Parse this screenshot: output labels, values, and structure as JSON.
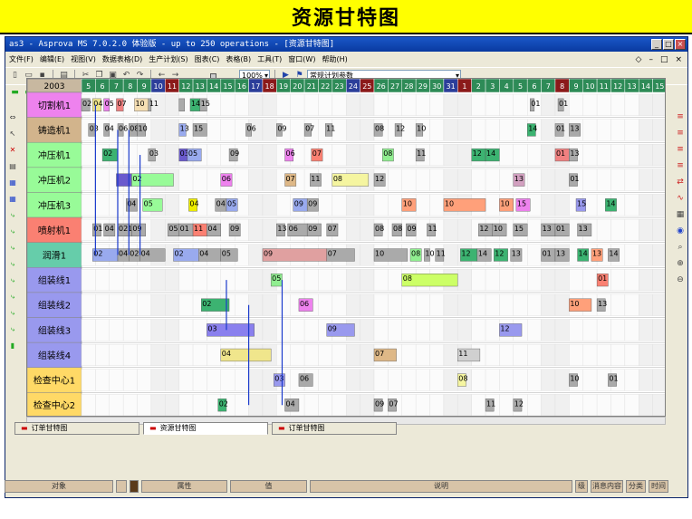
{
  "slide_title": "资源甘特图",
  "window": {
    "title": "as3 - Asprova MS 7.0.2.0 体验版 - up to 250 operations - [资源甘特图]",
    "buttons": [
      "_",
      "□",
      "×"
    ]
  },
  "menu": [
    "文件(F)",
    "编辑(E)",
    "视图(V)",
    "数据表格(D)",
    "生产计划(S)",
    "图表(C)",
    "表格(B)",
    "工具(T)",
    "窗口(W)",
    "帮助(H)"
  ],
  "toolbar": {
    "zoom_value": "100%",
    "plan_param_label": "常规计划参数"
  },
  "gantt": {
    "year": "2003",
    "dates": [
      "5",
      "6",
      "7",
      "8",
      "9",
      "10",
      "11",
      "12",
      "13",
      "14",
      "15",
      "16",
      "17",
      "18",
      "19",
      "20",
      "21",
      "22",
      "23",
      "24",
      "25",
      "26",
      "27",
      "28",
      "29",
      "30",
      "31",
      "1",
      "2",
      "3",
      "4",
      "5",
      "6",
      "7",
      "8",
      "9",
      "10",
      "11",
      "12",
      "13",
      "14",
      "15"
    ],
    "weekend_indices": [
      5,
      12,
      19,
      26
    ],
    "holiday_indices": [
      6,
      13,
      20,
      27,
      34
    ],
    "resources": [
      {
        "name": "切割机1",
        "color": "#ee82ee"
      },
      {
        "name": "铸造机1",
        "color": "#d2b48c"
      },
      {
        "name": "冲压机1",
        "color": "#98fb98"
      },
      {
        "name": "冲压机2",
        "color": "#98fb98"
      },
      {
        "name": "冲压机3",
        "color": "#98fb98"
      },
      {
        "name": "喷射机1",
        "color": "#fa8072"
      },
      {
        "name": "润滑1",
        "color": "#66cdaa"
      },
      {
        "name": "组装线1",
        "color": "#9999ee"
      },
      {
        "name": "组装线2",
        "color": "#9999ee"
      },
      {
        "name": "组装线3",
        "color": "#9999ee"
      },
      {
        "name": "组装线4",
        "color": "#9999ee"
      },
      {
        "name": "检查中心1",
        "color": "#ffd966"
      },
      {
        "name": "检查中心2",
        "color": "#ffd966"
      }
    ],
    "bars": [
      [
        [
          0.0,
          0.6,
          "#aaa",
          "02"
        ],
        [
          0.8,
          1.4,
          "#f0e68c",
          "04"
        ],
        [
          1.6,
          2.0,
          "#ee82ee",
          "05"
        ],
        [
          2.5,
          3.0,
          "#f08080",
          "07"
        ],
        [
          3.8,
          4.8,
          "#f5deb3",
          "10"
        ],
        [
          4.8,
          5.0,
          "#aaa",
          "11"
        ],
        [
          7.0,
          7.4,
          "#aaa",
          ""
        ],
        [
          7.8,
          8.5,
          "#3cb371",
          "14"
        ],
        [
          8.5,
          9.0,
          "#aaa",
          "15"
        ],
        [
          32.2,
          32.5,
          "#aaa",
          "01"
        ],
        [
          34.2,
          34.6,
          "#aaa",
          "01"
        ]
      ],
      [
        [
          0.5,
          1.0,
          "#aaa",
          "03"
        ],
        [
          1.6,
          2.0,
          "#aaa",
          "04"
        ],
        [
          2.6,
          3.0,
          "#aaa",
          "06"
        ],
        [
          3.4,
          4.0,
          "#aaa",
          "08"
        ],
        [
          4.0,
          4.6,
          "#aaa",
          "10"
        ],
        [
          7.0,
          7.5,
          "#9ae",
          "13"
        ],
        [
          8.0,
          9.0,
          "#aaa",
          "15"
        ],
        [
          11.8,
          12.2,
          "#aaa",
          "06"
        ],
        [
          14.0,
          14.4,
          "#aaa",
          "09"
        ],
        [
          16.0,
          16.5,
          "#aaa",
          "07"
        ],
        [
          17.5,
          18.0,
          "#aaa",
          "11"
        ],
        [
          21.0,
          21.6,
          "#aaa",
          "08"
        ],
        [
          22.5,
          23.0,
          "#aaa",
          "12"
        ],
        [
          24.0,
          24.5,
          "#aaa",
          "10"
        ],
        [
          32.0,
          32.6,
          "#3cb371",
          "14"
        ],
        [
          34.0,
          34.6,
          "#aaa",
          "01"
        ],
        [
          35.0,
          35.8,
          "#aaa",
          "13"
        ]
      ],
      [
        [
          1.5,
          2.6,
          "#3cb371",
          "02"
        ],
        [
          4.8,
          5.3,
          "#aaa",
          "03"
        ],
        [
          7.0,
          7.6,
          "#6a5acd",
          "03"
        ],
        [
          7.6,
          8.6,
          "#9ae",
          "05"
        ],
        [
          10.6,
          11.2,
          "#aaa",
          "09"
        ],
        [
          14.6,
          15.2,
          "#ee82ee",
          "06"
        ],
        [
          16.5,
          17.3,
          "#fa8072",
          "07"
        ],
        [
          21.6,
          22.4,
          "#90ee90",
          "08"
        ],
        [
          24.0,
          24.6,
          "#aaa",
          "11"
        ],
        [
          28.0,
          29.0,
          "#3cb371",
          "12"
        ],
        [
          29.0,
          30.0,
          "#3cb371",
          "14"
        ],
        [
          34.0,
          35.0,
          "#f08080",
          "01"
        ],
        [
          35.0,
          35.6,
          "#aaa",
          "13"
        ]
      ],
      [
        [
          2.5,
          3.6,
          "#6a5acd",
          ""
        ],
        [
          3.6,
          6.6,
          "#98fb98",
          "02"
        ],
        [
          10.0,
          10.8,
          "#ee82ee",
          "06"
        ],
        [
          14.6,
          15.4,
          "#deb887",
          "07"
        ],
        [
          16.4,
          17.2,
          "#aaa",
          "11"
        ],
        [
          18.0,
          20.6,
          "#f5f5a0",
          "08"
        ],
        [
          21.0,
          21.8,
          "#aaa",
          "12"
        ],
        [
          31.0,
          31.8,
          "#d2a0c0",
          "13"
        ],
        [
          35.0,
          35.6,
          "#aaa",
          "01"
        ]
      ],
      [
        [
          3.2,
          4.0,
          "#aaa",
          "04"
        ],
        [
          4.4,
          5.8,
          "#98fb98",
          "05"
        ],
        [
          7.7,
          8.3,
          "#ee0",
          "04"
        ],
        [
          9.6,
          10.4,
          "#aaa",
          "04"
        ],
        [
          10.4,
          11.2,
          "#9ae",
          "05"
        ],
        [
          15.2,
          16.2,
          "#9ae",
          "09"
        ],
        [
          16.2,
          17.0,
          "#aaa",
          "09"
        ],
        [
          23.0,
          24.0,
          "#ffa07a",
          "10"
        ],
        [
          26.0,
          29.0,
          "#ffa07a",
          "10"
        ],
        [
          30.0,
          31.0,
          "#ffa07a",
          "10"
        ],
        [
          31.2,
          32.2,
          "#ee82ee",
          "15"
        ],
        [
          35.5,
          36.2,
          "#9999ee",
          "15"
        ],
        [
          37.6,
          38.4,
          "#3cb371",
          "14"
        ]
      ],
      [
        [
          0.8,
          1.4,
          "#aaa",
          "01"
        ],
        [
          1.6,
          2.4,
          "#aaa",
          "04"
        ],
        [
          2.6,
          3.6,
          "#aaa",
          "0215"
        ],
        [
          3.6,
          4.6,
          "#aaa",
          "09"
        ],
        [
          6.2,
          7.0,
          "#aaa",
          "05"
        ],
        [
          7.0,
          8.0,
          "#aaa",
          "01"
        ],
        [
          8.0,
          9.0,
          "#fa8072",
          "11"
        ],
        [
          9.0,
          10.0,
          "#aaa",
          "04"
        ],
        [
          10.6,
          11.4,
          "#aaa",
          "09"
        ],
        [
          14.0,
          14.6,
          "#aaa",
          "13"
        ],
        [
          14.8,
          16.2,
          "#aaa",
          "06"
        ],
        [
          16.2,
          17.2,
          "#aaa",
          "09"
        ],
        [
          17.6,
          18.4,
          "#aaa",
          "07"
        ],
        [
          21.0,
          21.6,
          "#aaa",
          "08"
        ],
        [
          22.3,
          23.0,
          "#aaa",
          "08"
        ],
        [
          23.3,
          24.0,
          "#aaa",
          "09"
        ],
        [
          24.8,
          25.4,
          "#aaa",
          "11"
        ],
        [
          28.5,
          29.5,
          "#aaa",
          "12"
        ],
        [
          29.5,
          30.5,
          "#aaa",
          "10"
        ],
        [
          31.0,
          32.0,
          "#aaa",
          "15"
        ],
        [
          33.0,
          34.0,
          "#aaa",
          "13"
        ],
        [
          34.0,
          35.0,
          "#aaa",
          "01"
        ],
        [
          35.6,
          36.6,
          "#aaa",
          "13"
        ]
      ],
      [
        [
          0.8,
          2.6,
          "#9ae",
          "02"
        ],
        [
          2.6,
          3.4,
          "#aaa",
          "04"
        ],
        [
          3.4,
          4.2,
          "#aaa",
          "02"
        ],
        [
          4.2,
          6.0,
          "#aaa",
          "04"
        ],
        [
          6.6,
          8.4,
          "#9ae",
          "02"
        ],
        [
          8.4,
          10.0,
          "#aaa",
          "04"
        ],
        [
          10.0,
          11.2,
          "#aaa",
          "05"
        ],
        [
          13.0,
          17.6,
          "#e0a0a0",
          "09"
        ],
        [
          17.6,
          19.6,
          "#aaa",
          "07"
        ],
        [
          21.0,
          23.4,
          "#aaa",
          "10"
        ],
        [
          23.6,
          24.4,
          "#90ee90",
          "08"
        ],
        [
          24.6,
          25.0,
          "#aaa",
          "10"
        ],
        [
          25.4,
          26.0,
          "#aaa",
          "11"
        ],
        [
          27.2,
          28.4,
          "#3cb371",
          "12"
        ],
        [
          28.4,
          29.4,
          "#aaa",
          "14"
        ],
        [
          29.6,
          30.6,
          "#3cb371",
          "12"
        ],
        [
          30.8,
          31.6,
          "#aaa",
          "13"
        ],
        [
          33.0,
          34.0,
          "#aaa",
          "01"
        ],
        [
          34.0,
          35.0,
          "#aaa",
          "13"
        ],
        [
          35.6,
          36.4,
          "#3cb371",
          "14"
        ],
        [
          36.6,
          37.4,
          "#ffa07a",
          "13"
        ],
        [
          37.8,
          38.6,
          "#aaa",
          "14"
        ]
      ],
      [
        [
          13.6,
          14.4,
          "#90ee90",
          "05"
        ],
        [
          23.0,
          27.0,
          "#ccff66",
          "08"
        ],
        [
          37.0,
          37.8,
          "#fa8072",
          "01"
        ]
      ],
      [
        [
          8.6,
          10.6,
          "#3cb371",
          "02"
        ],
        [
          15.6,
          16.6,
          "#ee82ee",
          "06"
        ],
        [
          35.0,
          36.6,
          "#ffa07a",
          "10"
        ],
        [
          37.0,
          37.6,
          "#aaa",
          "13"
        ]
      ],
      [
        [
          9.0,
          12.4,
          "#8a80ee",
          "03"
        ],
        [
          17.6,
          19.6,
          "#9999ee",
          "09"
        ],
        [
          30.0,
          31.6,
          "#9999ee",
          "12"
        ]
      ],
      [
        [
          10.0,
          13.6,
          "#f0e68c",
          "04"
        ],
        [
          21.0,
          22.6,
          "#deb887",
          "07"
        ],
        [
          27.0,
          28.6,
          "#d0d0d0",
          "11"
        ]
      ],
      [
        [
          13.8,
          14.6,
          "#9999ee",
          "03"
        ],
        [
          15.6,
          16.6,
          "#aaa",
          "06"
        ],
        [
          27.0,
          27.6,
          "#f5f5a0",
          "08"
        ],
        [
          35.0,
          35.6,
          "#aaa",
          "10"
        ],
        [
          37.8,
          38.4,
          "#aaa",
          "01"
        ]
      ],
      [
        [
          9.8,
          10.4,
          "#3cb371",
          "02"
        ],
        [
          14.6,
          15.6,
          "#aaa",
          "04"
        ],
        [
          21.0,
          21.6,
          "#aaa",
          "09"
        ],
        [
          22.0,
          22.6,
          "#aaa",
          "07"
        ],
        [
          29.0,
          29.6,
          "#aaa",
          "11"
        ],
        [
          31.0,
          31.6,
          "#aaa",
          "12"
        ]
      ]
    ]
  },
  "tabs": [
    "订单甘特图",
    "资源甘特图",
    "订单甘特图"
  ],
  "properties_header": {
    "object": "对象",
    "attribute": "属性",
    "value": "值",
    "description": "说明",
    "right": [
      "级",
      "消息内容",
      "分类",
      "时间"
    ]
  }
}
